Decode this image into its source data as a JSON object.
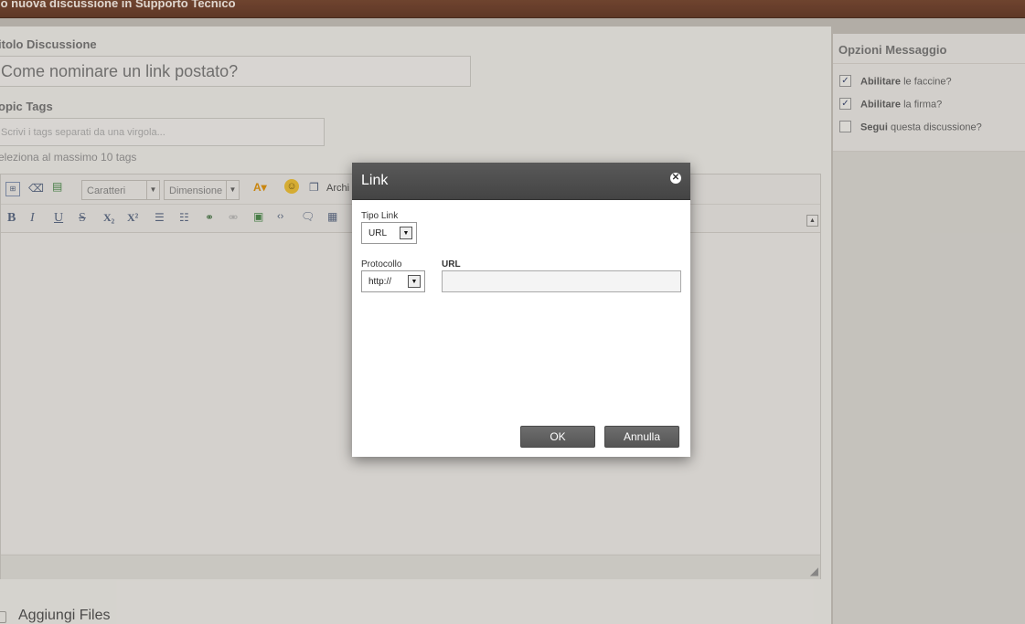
{
  "topbar": {
    "title": "lo nuova discussione in Supporto Tecnico"
  },
  "form": {
    "title_label": "itolo Discussione",
    "title_value": "Come nominare un link postato?",
    "tags_label": "opic Tags",
    "tags_placeholder": "Scrivi i tags separati da una virgola...",
    "tags_hint": "eleziona al massimo 10 tags"
  },
  "editor": {
    "font_combo": "Caratteri",
    "size_combo": "Dimensione",
    "archive_label": "Archi",
    "toolbar_format": [
      "B",
      "I",
      "U",
      "S",
      "X₂",
      "X²"
    ]
  },
  "attachments": {
    "label": "Aggiungi Files"
  },
  "sidebar": {
    "title": "Opzioni Messaggio",
    "options": [
      {
        "bold": "Abilitare",
        "text": " le faccine?",
        "checked": true
      },
      {
        "bold": "Abilitare",
        "text": " la firma?",
        "checked": true
      },
      {
        "bold": "Segui",
        "text": " questa discussione?",
        "checked": false
      }
    ]
  },
  "dialog": {
    "title": "Link",
    "link_type_label": "Tipo Link",
    "link_type_value": "URL",
    "protocol_label": "Protocollo",
    "protocol_value": "http://",
    "url_label": "URL",
    "url_value": "",
    "ok_label": "OK",
    "cancel_label": "Annulla"
  }
}
